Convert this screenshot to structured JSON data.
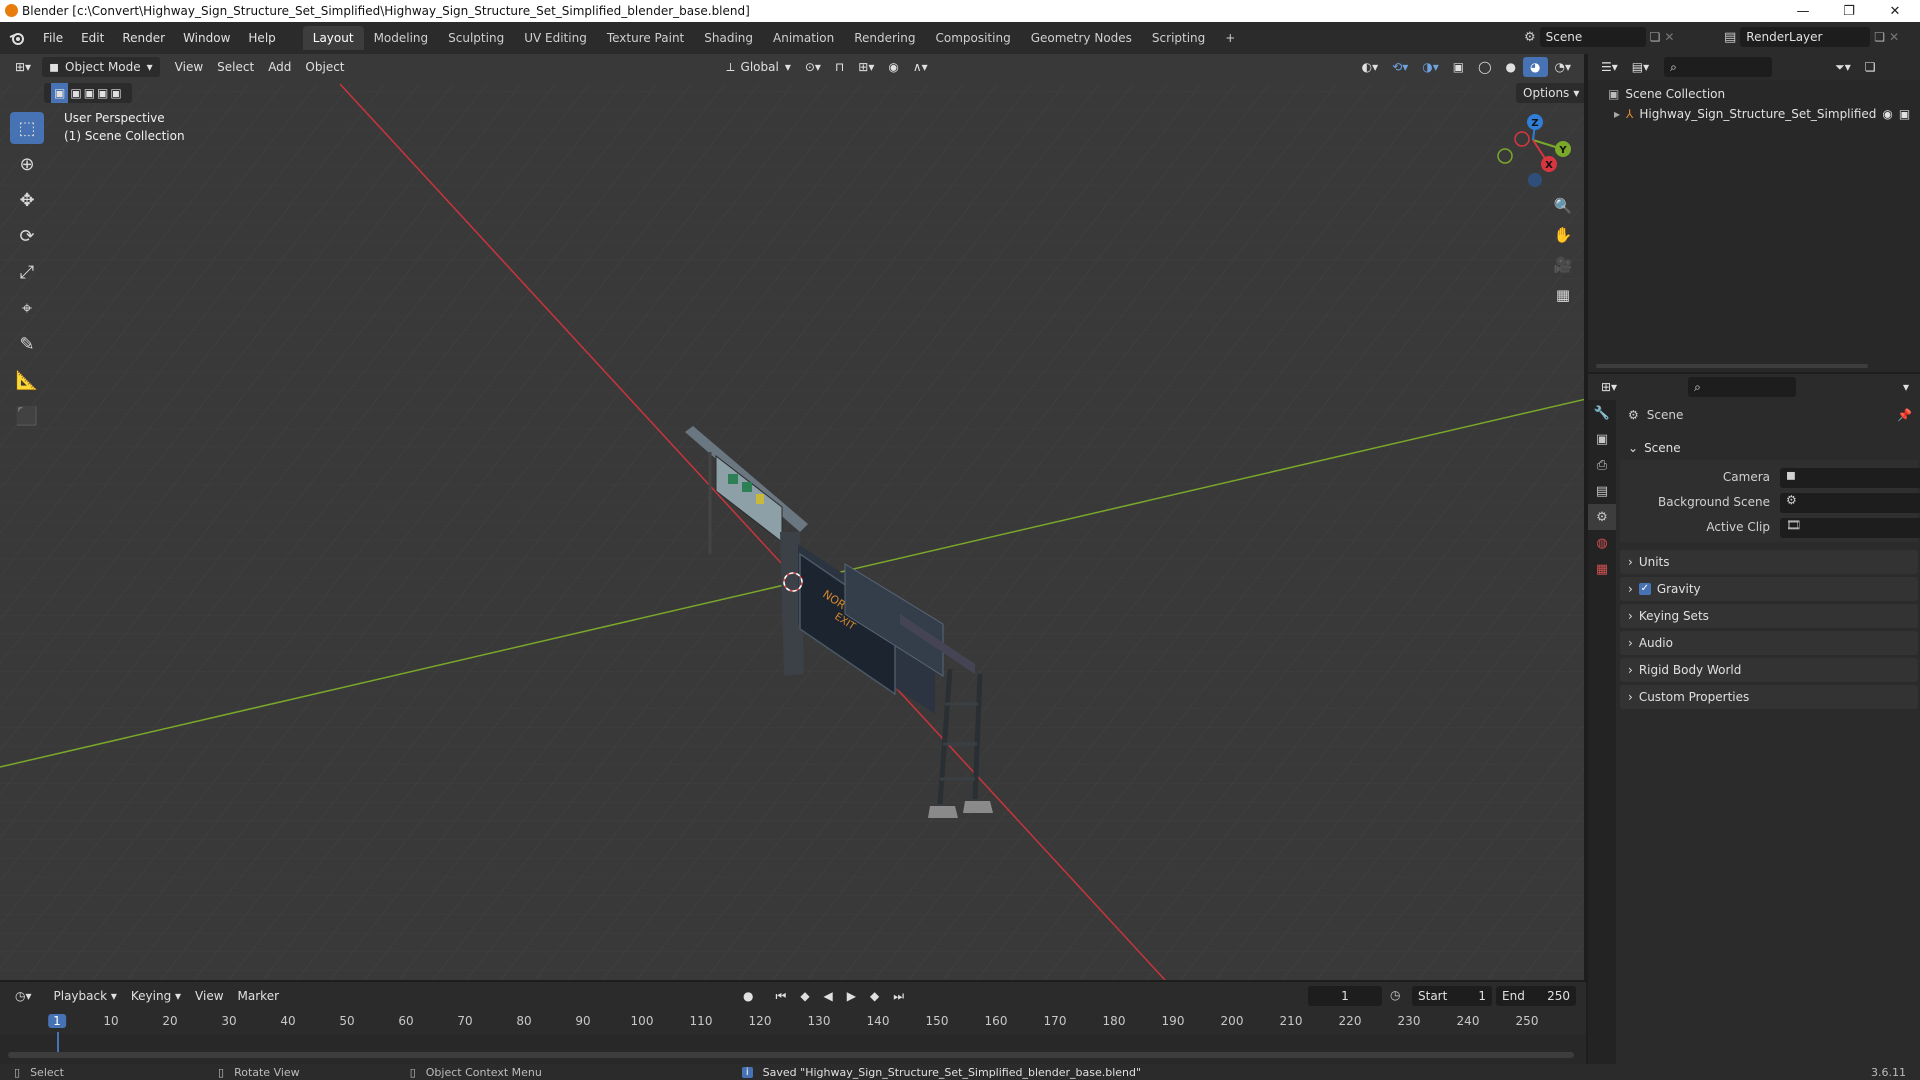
{
  "window": {
    "title": "Blender [c:\\Convert\\Highway_Sign_Structure_Set_Simplified\\Highway_Sign_Structure_Set_Simplified_blender_base.blend]",
    "minimize": "—",
    "maximize": "❐",
    "close": "✕"
  },
  "menus": [
    "File",
    "Edit",
    "Render",
    "Window",
    "Help"
  ],
  "workspaces": [
    "Layout",
    "Modeling",
    "Sculpting",
    "UV Editing",
    "Texture Paint",
    "Shading",
    "Animation",
    "Rendering",
    "Compositing",
    "Geometry Nodes",
    "Scripting"
  ],
  "active_workspace": "Layout",
  "add_workspace": "+",
  "scene_selector": {
    "value": "Scene"
  },
  "view_layer_selector": {
    "value": "RenderLayer"
  },
  "viewport": {
    "mode": "Object Mode",
    "menus": [
      "View",
      "Select",
      "Add",
      "Object"
    ],
    "transform_orientation": "Global",
    "options_label": "Options",
    "overlay_line1": "User Perspective",
    "overlay_line2": "(1) Scene Collection",
    "gizmo": {
      "x": "X",
      "y": "Y",
      "z": "Z"
    },
    "sign_text_1": "NORTH",
    "sign_text_2": "EXIT"
  },
  "timeline": {
    "menus": [
      "Playback",
      "Keying",
      "View",
      "Marker"
    ],
    "current_frame": "1",
    "start_label": "Start",
    "start": "1",
    "end_label": "End",
    "end": "250",
    "ruler_frames": [
      1,
      10,
      20,
      30,
      40,
      50,
      60,
      70,
      80,
      90,
      100,
      110,
      120,
      130,
      140,
      150,
      160,
      170,
      180,
      190,
      200,
      210,
      220,
      230,
      240,
      250
    ]
  },
  "statusbar": {
    "select": "Select",
    "rotate": "Rotate View",
    "context_menu": "Object Context Menu",
    "message": "Saved \"Highway_Sign_Structure_Set_Simplified_blender_base.blend\"",
    "version": "3.6.11"
  },
  "outliner": {
    "root": "Scene Collection",
    "items": [
      {
        "label": "Highway_Sign_Structure_Set_Simplified"
      }
    ]
  },
  "properties": {
    "context_title": "Scene",
    "section_scene": "Scene",
    "fields": [
      {
        "label": "Camera"
      },
      {
        "label": "Background Scene"
      },
      {
        "label": "Active Clip"
      }
    ],
    "panels": [
      {
        "label": "Units",
        "checkbox": false
      },
      {
        "label": "Gravity",
        "checkbox": true
      },
      {
        "label": "Keying Sets",
        "checkbox": false
      },
      {
        "label": "Audio",
        "checkbox": false
      },
      {
        "label": "Rigid Body World",
        "checkbox": false
      },
      {
        "label": "Custom Properties",
        "checkbox": false
      }
    ]
  },
  "colors": {
    "accent": "#4772b3",
    "x_axis": "#d8363f",
    "y_axis": "#89b52a",
    "z_axis": "#2f7fd8",
    "playhead": "#4772b3"
  }
}
